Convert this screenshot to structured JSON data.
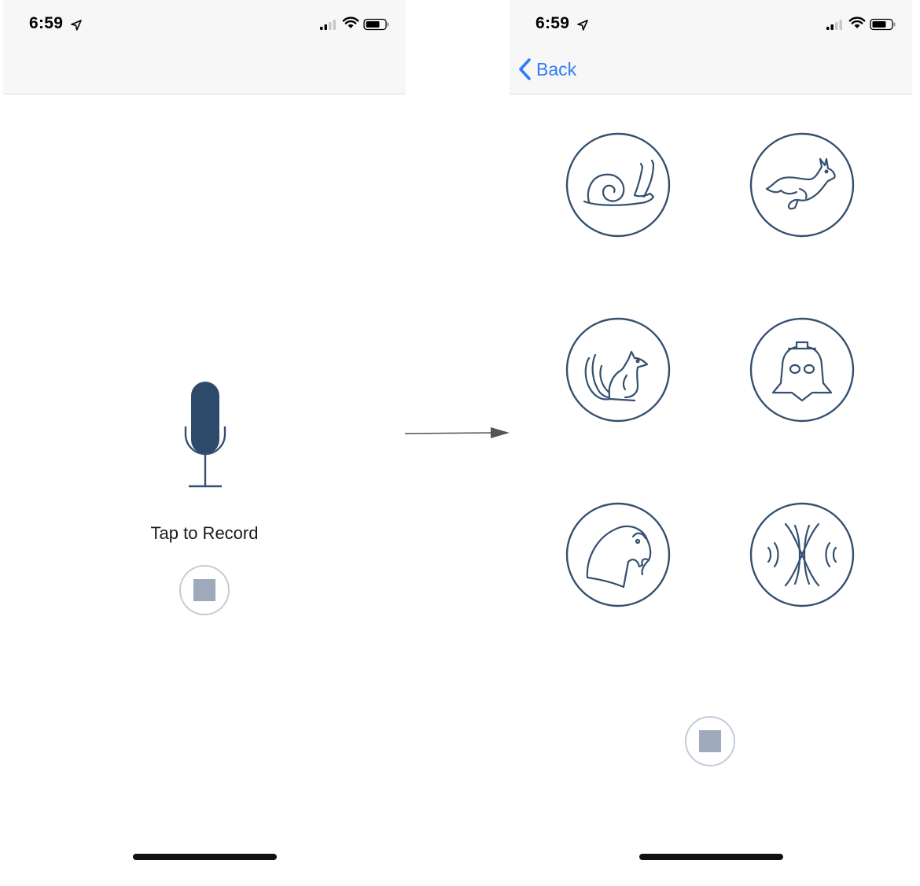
{
  "left_screen": {
    "status": {
      "time": "6:59"
    },
    "record_label": "Tap to Record",
    "icons": {
      "mic": "microphone-icon",
      "stop": "stop-icon"
    }
  },
  "right_screen": {
    "status": {
      "time": "6:59"
    },
    "nav": {
      "back_label": "Back"
    },
    "effects": [
      {
        "name": "snail",
        "icon": "snail-icon"
      },
      {
        "name": "rabbit",
        "icon": "rabbit-icon"
      },
      {
        "name": "squirrel",
        "icon": "squirrel-icon"
      },
      {
        "name": "villain",
        "icon": "helmet-icon"
      },
      {
        "name": "parrot",
        "icon": "parrot-icon"
      },
      {
        "name": "echo",
        "icon": "echo-icon"
      }
    ]
  },
  "colors": {
    "accent_navy": "#2d4a6b",
    "icon_stroke": "#34506f",
    "back_link": "#2f7cf6",
    "stop_fill": "#9ea9bb",
    "nav_background": "#f7f7f7"
  }
}
